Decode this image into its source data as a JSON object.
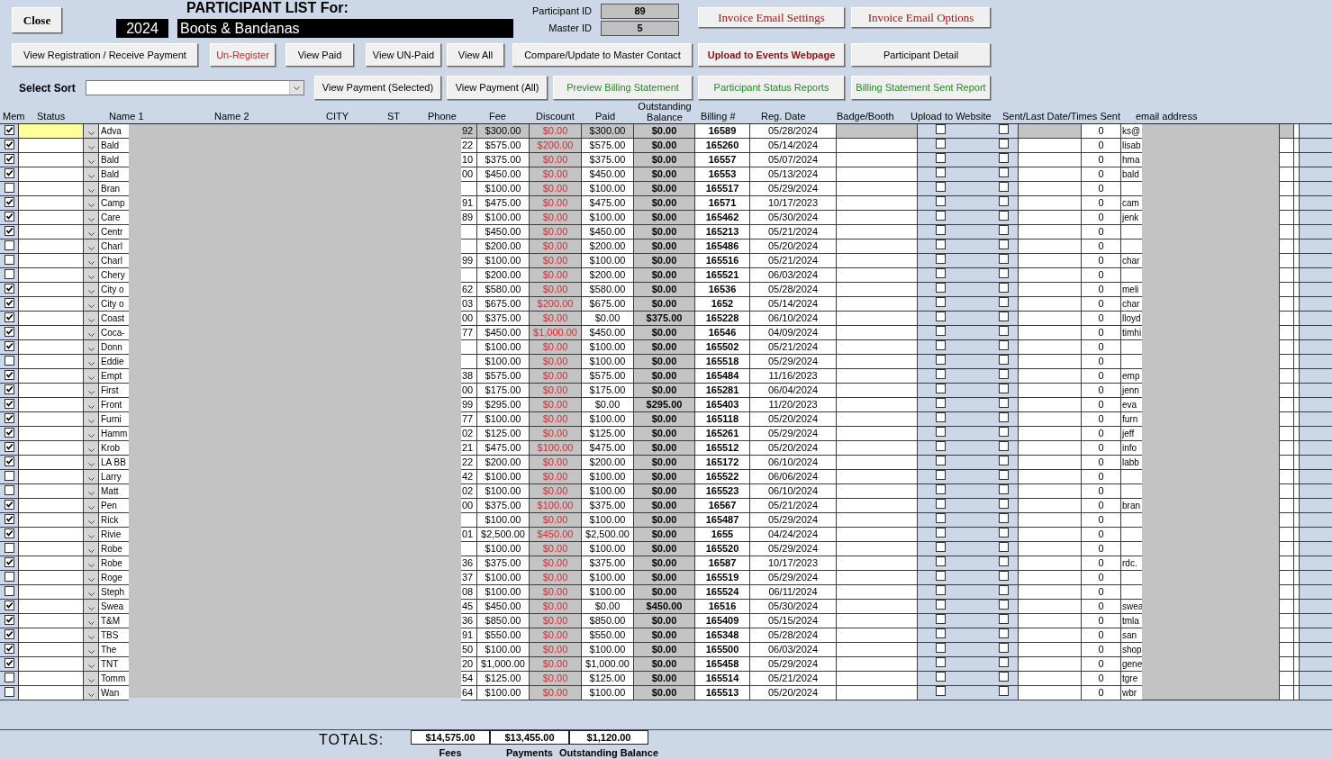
{
  "header": {
    "close_button": "Close",
    "title": "PARTICIPANT LIST For:",
    "year": "2024",
    "event": "Boots & Bandanas",
    "ids": [
      {
        "label": "Participant ID",
        "value": "89"
      },
      {
        "label": "Master ID",
        "value": "5"
      }
    ],
    "email_buttons": [
      {
        "label": "Invoice Email Settings",
        "kind": "serif"
      },
      {
        "label": "Invoice Email Options",
        "kind": "serif"
      }
    ]
  },
  "action_buttons": [
    {
      "label": "View Registration / Receive Payment",
      "kind": "plain"
    },
    {
      "label": "Un-Register",
      "kind": "danger"
    },
    {
      "label": "View Paid",
      "kind": "plain"
    },
    {
      "label": "View UN-Paid",
      "kind": "plain"
    },
    {
      "label": "View All",
      "kind": "plain"
    },
    {
      "label": "Compare/Update to Master Contact",
      "kind": "plain"
    },
    {
      "label": "Upload to Events Webpage",
      "kind": "emphasis"
    },
    {
      "label": "Participant Detail",
      "kind": "plain"
    }
  ],
  "sort": {
    "label": "Select Sort"
  },
  "report_buttons": [
    {
      "label": "View Payment (Selected)",
      "kind": "plain"
    },
    {
      "label": "View Payment (All)",
      "kind": "plain"
    },
    {
      "label": "Preview Billing Statement",
      "kind": "report"
    },
    {
      "label": "Participant Status Reports",
      "kind": "report"
    },
    {
      "label": "Billing Statement Sent Report",
      "kind": "report"
    }
  ],
  "table": {
    "columns": [
      "Mem",
      "Status",
      "Name 1",
      "Name 2",
      "CITY",
      "ST",
      "Phone",
      "Fee",
      "Discount",
      "Paid",
      "Outstanding Balance",
      "Billing #",
      "Reg. Date",
      "Badge/Booth",
      "Upload to Website",
      "Sent/Last Date/Times Sent",
      "email address"
    ],
    "rows": [
      {
        "member": true,
        "selected": true,
        "name_1": "Adva",
        "phone": "92",
        "fee": "$300.00",
        "discount": "$0.00",
        "paid": "$300.00",
        "balance": "$0.00",
        "billing_no": "16589",
        "reg_date": "05/28/2024",
        "uploaded": false,
        "sent": false,
        "times_sent": "0",
        "email": "ks@"
      },
      {
        "member": true,
        "selected": false,
        "name_1": "Bald",
        "phone": "22",
        "fee": "$575.00",
        "discount": "$200.00",
        "paid": "$575.00",
        "balance": "$0.00",
        "billing_no": "165260",
        "reg_date": "05/14/2024",
        "uploaded": false,
        "sent": false,
        "times_sent": "0",
        "email": "lisab"
      },
      {
        "member": true,
        "selected": false,
        "name_1": "Bald",
        "phone": "10",
        "fee": "$375.00",
        "discount": "$0.00",
        "paid": "$375.00",
        "balance": "$0.00",
        "billing_no": "16557",
        "reg_date": "05/07/2024",
        "uploaded": false,
        "sent": false,
        "times_sent": "0",
        "email": "hma"
      },
      {
        "member": true,
        "selected": false,
        "name_1": "Bald",
        "phone": "00",
        "fee": "$450.00",
        "discount": "$0.00",
        "paid": "$450.00",
        "balance": "$0.00",
        "billing_no": "16553",
        "reg_date": "05/13/2024",
        "uploaded": false,
        "sent": false,
        "times_sent": "0",
        "email": "bald"
      },
      {
        "member": false,
        "selected": false,
        "name_1": "Bran",
        "fee": "$100.00",
        "discount": "$0.00",
        "paid": "$100.00",
        "balance": "$0.00",
        "billing_no": "165517",
        "reg_date": "05/29/2024",
        "uploaded": false,
        "sent": false,
        "times_sent": "0"
      },
      {
        "member": true,
        "selected": false,
        "name_1": "Camp",
        "phone": "91",
        "fee": "$475.00",
        "discount": "$0.00",
        "paid": "$475.00",
        "balance": "$0.00",
        "billing_no": "16571",
        "reg_date": "10/17/2023",
        "uploaded": false,
        "sent": false,
        "times_sent": "0",
        "email": "cam"
      },
      {
        "member": true,
        "selected": false,
        "name_1": "Care",
        "phone": "89",
        "fee": "$100.00",
        "discount": "$0.00",
        "paid": "$100.00",
        "balance": "$0.00",
        "billing_no": "165462",
        "reg_date": "05/30/2024",
        "uploaded": false,
        "sent": false,
        "times_sent": "0",
        "email": "jenk"
      },
      {
        "member": true,
        "selected": false,
        "name_1": "Centr",
        "fee": "$450.00",
        "discount": "$0.00",
        "paid": "$450.00",
        "balance": "$0.00",
        "billing_no": "165213",
        "reg_date": "05/21/2024",
        "uploaded": false,
        "sent": false,
        "times_sent": "0"
      },
      {
        "member": false,
        "selected": false,
        "name_1": "Charl",
        "fee": "$200.00",
        "discount": "$0.00",
        "paid": "$200.00",
        "balance": "$0.00",
        "billing_no": "165486",
        "reg_date": "05/20/2024",
        "uploaded": false,
        "sent": false,
        "times_sent": "0"
      },
      {
        "member": false,
        "selected": false,
        "name_1": "Charl",
        "phone": "99",
        "fee": "$100.00",
        "discount": "$0.00",
        "paid": "$100.00",
        "balance": "$0.00",
        "billing_no": "165516",
        "reg_date": "05/21/2024",
        "uploaded": false,
        "sent": false,
        "times_sent": "0",
        "email": "char"
      },
      {
        "member": false,
        "selected": false,
        "name_1": "Chery",
        "fee": "$200.00",
        "discount": "$0.00",
        "paid": "$200.00",
        "balance": "$0.00",
        "billing_no": "165521",
        "reg_date": "06/03/2024",
        "uploaded": false,
        "sent": false,
        "times_sent": "0"
      },
      {
        "member": true,
        "selected": false,
        "name_1": "City o",
        "phone": "62",
        "fee": "$580.00",
        "discount": "$0.00",
        "paid": "$580.00",
        "balance": "$0.00",
        "billing_no": "16536",
        "reg_date": "05/28/2024",
        "uploaded": false,
        "sent": false,
        "times_sent": "0",
        "email": "meli"
      },
      {
        "member": true,
        "selected": false,
        "name_1": "City o",
        "phone": "03",
        "fee": "$675.00",
        "discount": "$200.00",
        "paid": "$675.00",
        "balance": "$0.00",
        "billing_no": "1652",
        "reg_date": "05/14/2024",
        "uploaded": false,
        "sent": false,
        "times_sent": "0",
        "email": "char"
      },
      {
        "member": true,
        "selected": false,
        "name_1": "Coast",
        "phone": "00",
        "fee": "$375.00",
        "discount": "$0.00",
        "paid": "$0.00",
        "balance": "$375.00",
        "billing_no": "165228",
        "reg_date": "06/10/2024",
        "uploaded": false,
        "sent": false,
        "times_sent": "0",
        "email": "lloyd"
      },
      {
        "member": true,
        "selected": false,
        "name_1": "Coca-",
        "phone": "77",
        "fee": "$450.00",
        "discount": "$1,000.00",
        "paid": "$450.00",
        "balance": "$0.00",
        "billing_no": "16546",
        "reg_date": "04/09/2024",
        "uploaded": false,
        "sent": false,
        "times_sent": "0",
        "email": "timhi"
      },
      {
        "member": true,
        "selected": false,
        "name_1": "Donn",
        "fee": "$100.00",
        "discount": "$0.00",
        "paid": "$100.00",
        "balance": "$0.00",
        "billing_no": "165502",
        "reg_date": "05/21/2024",
        "uploaded": false,
        "sent": false,
        "times_sent": "0"
      },
      {
        "member": false,
        "selected": false,
        "name_1": "Eddie",
        "fee": "$100.00",
        "discount": "$0.00",
        "paid": "$100.00",
        "balance": "$0.00",
        "billing_no": "165518",
        "reg_date": "05/29/2024",
        "uploaded": false,
        "sent": false,
        "times_sent": "0"
      },
      {
        "member": true,
        "selected": false,
        "name_1": "Empt",
        "phone": "38",
        "fee": "$575.00",
        "discount": "$0.00",
        "paid": "$575.00",
        "balance": "$0.00",
        "billing_no": "165484",
        "reg_date": "11/16/2023",
        "uploaded": false,
        "sent": false,
        "times_sent": "0",
        "email": "emp"
      },
      {
        "member": true,
        "selected": false,
        "name_1": "First",
        "phone": "00",
        "fee": "$175.00",
        "discount": "$0.00",
        "paid": "$175.00",
        "balance": "$0.00",
        "billing_no": "165281",
        "reg_date": "06/04/2024",
        "uploaded": false,
        "sent": false,
        "times_sent": "0",
        "email": "jenn"
      },
      {
        "member": true,
        "selected": false,
        "name_1": "Front",
        "phone": "99",
        "fee": "$295.00",
        "discount": "$0.00",
        "paid": "$0.00",
        "balance": "$295.00",
        "billing_no": "165403",
        "reg_date": "11/20/2023",
        "uploaded": false,
        "sent": false,
        "times_sent": "0",
        "email": "eva"
      },
      {
        "member": true,
        "selected": false,
        "name_1": "Furni",
        "phone": "77",
        "fee": "$100.00",
        "discount": "$0.00",
        "paid": "$100.00",
        "balance": "$0.00",
        "billing_no": "165118",
        "reg_date": "05/20/2024",
        "uploaded": false,
        "sent": false,
        "times_sent": "0",
        "email": "furn"
      },
      {
        "member": true,
        "selected": false,
        "name_1": "Hamm",
        "phone": "02",
        "fee": "$125.00",
        "discount": "$0.00",
        "paid": "$125.00",
        "balance": "$0.00",
        "billing_no": "165261",
        "reg_date": "05/29/2024",
        "uploaded": false,
        "sent": false,
        "times_sent": "0",
        "email": "jeff"
      },
      {
        "member": true,
        "selected": false,
        "name_1": "Krob",
        "phone": "21",
        "fee": "$475.00",
        "discount": "$100.00",
        "paid": "$475.00",
        "balance": "$0.00",
        "billing_no": "165512",
        "reg_date": "05/20/2024",
        "uploaded": false,
        "sent": false,
        "times_sent": "0",
        "email": "info"
      },
      {
        "member": true,
        "selected": false,
        "name_1": "LA BB",
        "phone": "22",
        "fee": "$200.00",
        "discount": "$0.00",
        "paid": "$200.00",
        "balance": "$0.00",
        "billing_no": "165172",
        "reg_date": "06/10/2024",
        "uploaded": false,
        "sent": false,
        "times_sent": "0",
        "email": "labb"
      },
      {
        "member": false,
        "selected": false,
        "name_1": "Larry",
        "phone": "42",
        "fee": "$100.00",
        "discount": "$0.00",
        "paid": "$100.00",
        "balance": "$0.00",
        "billing_no": "165522",
        "reg_date": "06/06/2024",
        "uploaded": false,
        "sent": false,
        "times_sent": "0"
      },
      {
        "member": false,
        "selected": false,
        "name_1": "Matt",
        "phone": "02",
        "fee": "$100.00",
        "discount": "$0.00",
        "paid": "$100.00",
        "balance": "$0.00",
        "billing_no": "165523",
        "reg_date": "06/10/2024",
        "uploaded": false,
        "sent": false,
        "times_sent": "0"
      },
      {
        "member": true,
        "selected": false,
        "name_1": "Pen",
        "phone": "00",
        "fee": "$375.00",
        "discount": "$100.00",
        "paid": "$375.00",
        "balance": "$0.00",
        "billing_no": "16567",
        "reg_date": "05/21/2024",
        "uploaded": false,
        "sent": false,
        "times_sent": "0",
        "email": "bran"
      },
      {
        "member": true,
        "selected": false,
        "name_1": "Rick",
        "fee": "$100.00",
        "discount": "$0.00",
        "paid": "$100.00",
        "balance": "$0.00",
        "billing_no": "165487",
        "reg_date": "05/29/2024",
        "uploaded": false,
        "sent": false,
        "times_sent": "0"
      },
      {
        "member": true,
        "selected": false,
        "name_1": "Rivie",
        "phone": "01",
        "fee": "$2,500.00",
        "discount": "$450.00",
        "paid": "$2,500.00",
        "balance": "$0.00",
        "billing_no": "1655",
        "reg_date": "04/24/2024",
        "uploaded": false,
        "sent": false,
        "times_sent": "0"
      },
      {
        "member": false,
        "selected": false,
        "name_1": "Robe",
        "fee": "$100.00",
        "discount": "$0.00",
        "paid": "$100.00",
        "balance": "$0.00",
        "billing_no": "165520",
        "reg_date": "05/29/2024",
        "uploaded": false,
        "sent": false,
        "times_sent": "0"
      },
      {
        "member": true,
        "selected": false,
        "name_1": "Robe",
        "phone": "36",
        "fee": "$375.00",
        "discount": "$0.00",
        "paid": "$375.00",
        "balance": "$0.00",
        "billing_no": "16587",
        "reg_date": "10/17/2023",
        "uploaded": false,
        "sent": false,
        "times_sent": "0",
        "email": "rdc."
      },
      {
        "member": false,
        "selected": false,
        "name_1": "Roge",
        "phone": "37",
        "fee": "$100.00",
        "discount": "$0.00",
        "paid": "$100.00",
        "balance": "$0.00",
        "billing_no": "165519",
        "reg_date": "05/29/2024",
        "uploaded": false,
        "sent": false,
        "times_sent": "0"
      },
      {
        "member": false,
        "selected": false,
        "name_1": "Steph",
        "phone": "08",
        "fee": "$100.00",
        "discount": "$0.00",
        "paid": "$100.00",
        "balance": "$0.00",
        "billing_no": "165524",
        "reg_date": "06/11/2024",
        "uploaded": false,
        "sent": false,
        "times_sent": "0"
      },
      {
        "member": true,
        "selected": false,
        "name_1": "Swea",
        "phone": "45",
        "fee": "$450.00",
        "discount": "$0.00",
        "paid": "$0.00",
        "balance": "$450.00",
        "billing_no": "16516",
        "reg_date": "05/30/2024",
        "uploaded": false,
        "sent": false,
        "times_sent": "0",
        "email": "swea"
      },
      {
        "member": true,
        "selected": false,
        "name_1": "T&M",
        "phone": "36",
        "fee": "$850.00",
        "discount": "$0.00",
        "paid": "$850.00",
        "balance": "$0.00",
        "billing_no": "165409",
        "reg_date": "05/15/2024",
        "uploaded": false,
        "sent": false,
        "times_sent": "0",
        "email": "tmla"
      },
      {
        "member": true,
        "selected": false,
        "name_1": "TBS",
        "phone": "91",
        "fee": "$550.00",
        "discount": "$0.00",
        "paid": "$550.00",
        "balance": "$0.00",
        "billing_no": "165348",
        "reg_date": "05/28/2024",
        "uploaded": false,
        "sent": false,
        "times_sent": "0",
        "email": "san"
      },
      {
        "member": true,
        "selected": false,
        "name_1": "The",
        "phone": "50",
        "fee": "$100.00",
        "discount": "$0.00",
        "paid": "$100.00",
        "balance": "$0.00",
        "billing_no": "165500",
        "reg_date": "06/03/2024",
        "uploaded": false,
        "sent": false,
        "times_sent": "0",
        "email": "shop"
      },
      {
        "member": true,
        "selected": false,
        "name_1": "TNT",
        "phone": "20",
        "fee": "$1,000.00",
        "discount": "$0.00",
        "paid": "$1,000.00",
        "balance": "$0.00",
        "billing_no": "165458",
        "reg_date": "05/29/2024",
        "uploaded": false,
        "sent": false,
        "times_sent": "0",
        "email": "gene"
      },
      {
        "member": false,
        "selected": false,
        "name_1": "Tomm",
        "phone": "54",
        "fee": "$125.00",
        "discount": "$0.00",
        "paid": "$125.00",
        "balance": "$0.00",
        "billing_no": "165514",
        "reg_date": "05/21/2024",
        "uploaded": false,
        "sent": false,
        "times_sent": "0",
        "email": "tgre"
      },
      {
        "member": false,
        "selected": false,
        "name_1": "Wan",
        "phone": "64",
        "fee": "$100.00",
        "discount": "$0.00",
        "paid": "$100.00",
        "balance": "$0.00",
        "billing_no": "165513",
        "reg_date": "05/20/2024",
        "uploaded": false,
        "sent": false,
        "times_sent": "0",
        "email": "wbr"
      }
    ]
  },
  "totals": {
    "label": "TOTALS:",
    "items": [
      {
        "value": "$14,575.00",
        "label": "Fees"
      },
      {
        "value": "$13,455.00",
        "label": "Payments"
      },
      {
        "value": "$1,120.00",
        "label": "Outstanding Balance"
      }
    ]
  }
}
